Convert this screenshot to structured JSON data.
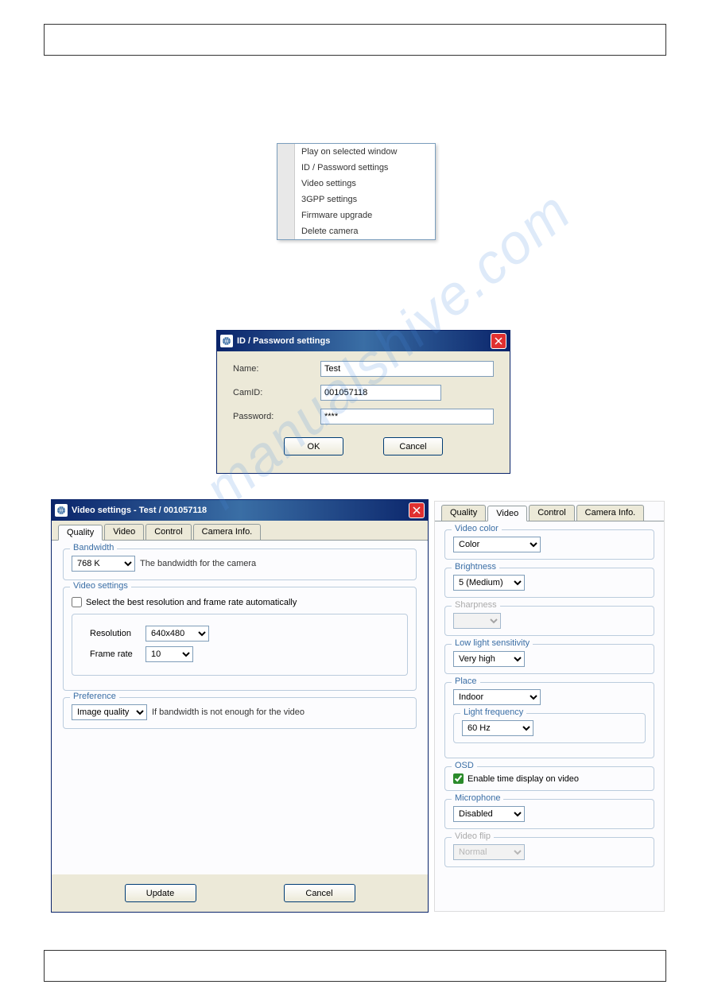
{
  "contextMenu": {
    "items": [
      "Play on selected window",
      "ID / Password settings",
      "Video settings",
      "3GPP settings",
      "Firmware upgrade",
      "Delete camera"
    ]
  },
  "idPasswordDialog": {
    "title": "ID / Password settings",
    "name_label": "Name:",
    "name_value": "Test",
    "camid_label": "CamID:",
    "camid_value": "001057118",
    "password_label": "Password:",
    "password_value": "****",
    "ok_label": "OK",
    "cancel_label": "Cancel"
  },
  "videoSettingsDialog": {
    "title": "Video settings - Test / 001057118",
    "tabs": [
      "Quality",
      "Video",
      "Control",
      "Camera Info."
    ],
    "active_tab": "Quality",
    "bandwidth": {
      "legend": "Bandwidth",
      "value": "768 K",
      "note": "The bandwidth for the camera"
    },
    "videoSettings": {
      "legend": "Video settings",
      "auto_checkbox_label": "Select the best resolution and frame rate automatically",
      "auto_checked": false,
      "resolution_label": "Resolution",
      "resolution_value": "640x480",
      "framerate_label": "Frame rate",
      "framerate_value": "10"
    },
    "preference": {
      "legend": "Preference",
      "value": "Image quality",
      "note": "If bandwidth is not enough for the video"
    },
    "update_label": "Update",
    "cancel_label": "Cancel"
  },
  "videoTabPanel": {
    "tabs": [
      "Quality",
      "Video",
      "Control",
      "Camera Info."
    ],
    "active_tab": "Video",
    "videoColor": {
      "legend": "Video color",
      "value": "Color"
    },
    "brightness": {
      "legend": "Brightness",
      "value": "5 (Medium)"
    },
    "sharpness": {
      "legend": "Sharpness",
      "value": ""
    },
    "lowLight": {
      "legend": "Low light sensitivity",
      "value": "Very high"
    },
    "place": {
      "legend": "Place",
      "value": "Indoor",
      "lightFreq": {
        "legend": "Light frequency",
        "value": "60 Hz"
      }
    },
    "osd": {
      "legend": "OSD",
      "checkbox_label": "Enable time display on video",
      "checked": true
    },
    "microphone": {
      "legend": "Microphone",
      "value": "Disabled"
    },
    "videoFlip": {
      "legend": "Video flip",
      "value": "Normal"
    }
  }
}
